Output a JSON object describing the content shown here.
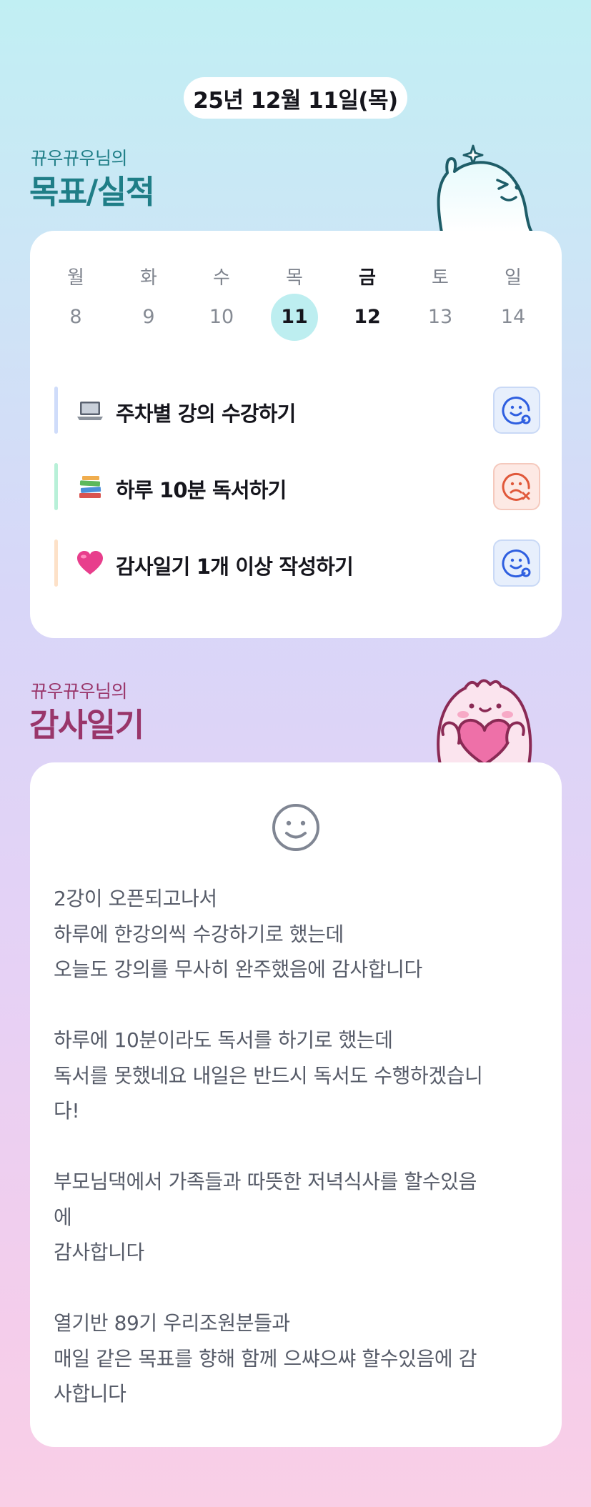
{
  "header": {
    "date": "25년 12월 11일(목)"
  },
  "goals_section": {
    "owner": "뀨우뀨우님의",
    "title": "목표/실적",
    "weekdays": [
      "월",
      "화",
      "수",
      "목",
      "금",
      "토",
      "일"
    ],
    "days": [
      "8",
      "9",
      "10",
      "11",
      "12",
      "13",
      "14"
    ],
    "goals": [
      {
        "emoji": "laptop-icon",
        "text": "주차별 강의 수강하기",
        "bar_color": "#cfdcfa",
        "status": "done"
      },
      {
        "emoji": "books-icon",
        "text": "하루 10분 독서하기",
        "bar_color": "#b8f0d8",
        "status": "missed"
      },
      {
        "emoji": "heart-icon",
        "text": "감사일기 1개 이상 작성하기",
        "bar_color": "#fde1c8",
        "status": "done"
      }
    ]
  },
  "diary_section": {
    "owner": "뀨우뀨우님의",
    "title": "감사일기",
    "lines": [
      "2강이 오픈되고나서",
      "하루에 한강의씩 수강하기로 했는데",
      "오늘도 강의를 무사히 완주했음에 감사합니다",
      "",
      "하루에 10분이라도 독서를 하기로 했는데",
      "독서를 못했네요 내일은 반드시 독서도 수행하겠습니",
      "다!",
      "",
      "부모님댁에서 가족들과 따뜻한 저녁식사를 할수있음",
      "에",
      "감사합니다",
      "",
      "열기반 89기 우리조원분들과",
      "매일 같은 목표를 향해 함께 으쌰으쌰 할수있음에 감",
      "사합니다"
    ]
  },
  "colors": {
    "accent_teal": "#1f7e87",
    "accent_plum": "#99356a",
    "today_highlight": "#bdeef0",
    "status_ok": "#2f5fe0",
    "status_fail": "#e0583a"
  }
}
